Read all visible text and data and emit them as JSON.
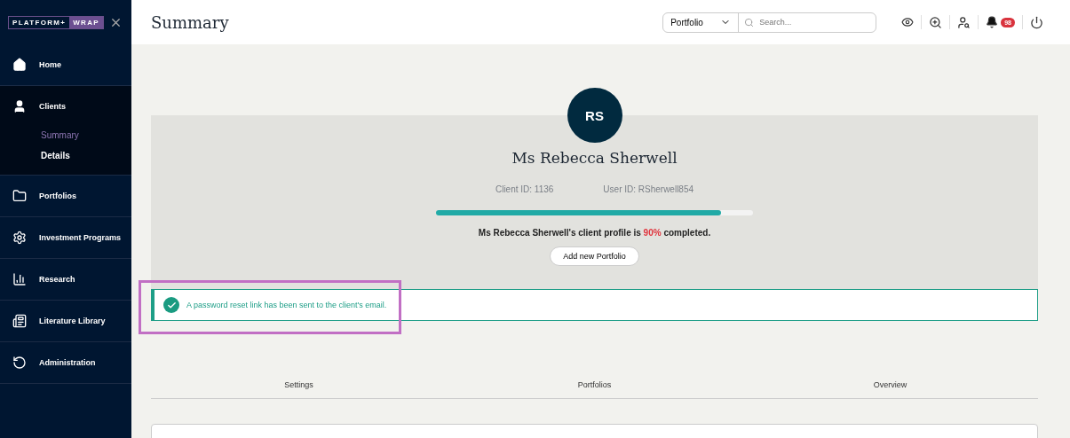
{
  "logo": {
    "left": "PLATFORM+",
    "right": "WRAP"
  },
  "sidebar": {
    "items": [
      {
        "kind": "home",
        "label": "Home",
        "expanded": false
      },
      {
        "kind": "clients",
        "label": "Clients",
        "expanded": true,
        "children": [
          {
            "label": "Summary",
            "selected": true
          },
          {
            "label": "Details",
            "selected": false
          }
        ]
      },
      {
        "kind": "portfolios",
        "label": "Portfolios",
        "expanded": false
      },
      {
        "kind": "programs",
        "label": "Investment Programs",
        "expanded": false
      },
      {
        "kind": "research",
        "label": "Research",
        "expanded": false
      },
      {
        "kind": "library",
        "label": "Literature Library",
        "expanded": false
      },
      {
        "kind": "admin",
        "label": "Administration",
        "expanded": false
      }
    ]
  },
  "header": {
    "title": "Summary",
    "scope": "Portfolio",
    "search": {
      "placeholder": "Search..."
    },
    "notifications": "98"
  },
  "profile": {
    "initials": "RS",
    "name": "Ms Rebecca Sherwell",
    "client_id": "Client ID: 1136",
    "user_id": "User ID: RSherwell854",
    "level": 0.9,
    "completion": {
      "prefix": "Ms Rebecca Sherwell's client profile is ",
      "percent": "90%",
      "suffix": " completed."
    },
    "button": "Add new Portfolio"
  },
  "alert": {
    "text": "A password reset link has been sent to the client's email.",
    "highlighted": true
  },
  "tabs": [
    {
      "label": "Settings",
      "selected": false
    },
    {
      "label": "Portfolios",
      "selected": false
    },
    {
      "label": "Overview",
      "selected": false
    }
  ]
}
